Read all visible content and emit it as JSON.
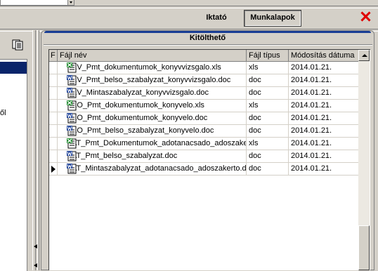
{
  "header": {
    "iktato_label": "Iktató",
    "munkalapok_label": "Munkalapok"
  },
  "left_panel": {
    "partial_text": "ől"
  },
  "tab": {
    "title": "Kitölthető"
  },
  "grid": {
    "columns": [
      "F",
      "Fájl név",
      "Fájl típus",
      "Módosítás dátuma"
    ],
    "rows": [
      {
        "icon": "xls-icon",
        "name": "KV_Pmt_dokumentumok_konyvvizsgalo.xls",
        "type": "xls",
        "date": "2014.01.21.",
        "current": false
      },
      {
        "icon": "doc-icon",
        "name": "KV_Pmt_belso_szabalyzat_konyvvizsgalo.doc",
        "type": "doc",
        "date": "2014.01.21.",
        "current": false
      },
      {
        "icon": "doc-icon",
        "name": "KV_Mintaszabalyzat_konyvvizsgalo.doc",
        "type": "doc",
        "date": "2014.01.21.",
        "current": false
      },
      {
        "icon": "xls-icon",
        "name": "KO_Pmt_dokumentumok_konyvelo.xls",
        "type": "xls",
        "date": "2014.01.21.",
        "current": false
      },
      {
        "icon": "doc-icon",
        "name": "KO_Pmt_dokumentumok_konyvelo.doc",
        "type": "doc",
        "date": "2014.01.21.",
        "current": false
      },
      {
        "icon": "doc-icon",
        "name": "KO_Pmt_belso_szabalyzat_konyvelo.doc",
        "type": "doc",
        "date": "2014.01.21.",
        "current": false
      },
      {
        "icon": "xls-icon",
        "name": "AT_Pmt_Dokumentumok_adotanacsado_adoszakerto.xls",
        "type": "xls",
        "date": "2014.01.21.",
        "current": false
      },
      {
        "icon": "doc-icon",
        "name": "AT_Pmt_belso_szabalyzat.doc",
        "type": "doc",
        "date": "2014.01.21.",
        "current": false
      },
      {
        "icon": "doc-icon",
        "name": "AT_Mintaszabalyzat_adotanacsado_adoszakerto.doc",
        "type": "doc",
        "date": "2014.01.21.",
        "current": true
      }
    ]
  },
  "colors": {
    "accent_blue": "#1b3f96",
    "selection": "#0a246a",
    "close_red": "#e00000",
    "face": "#d4d0c8"
  }
}
